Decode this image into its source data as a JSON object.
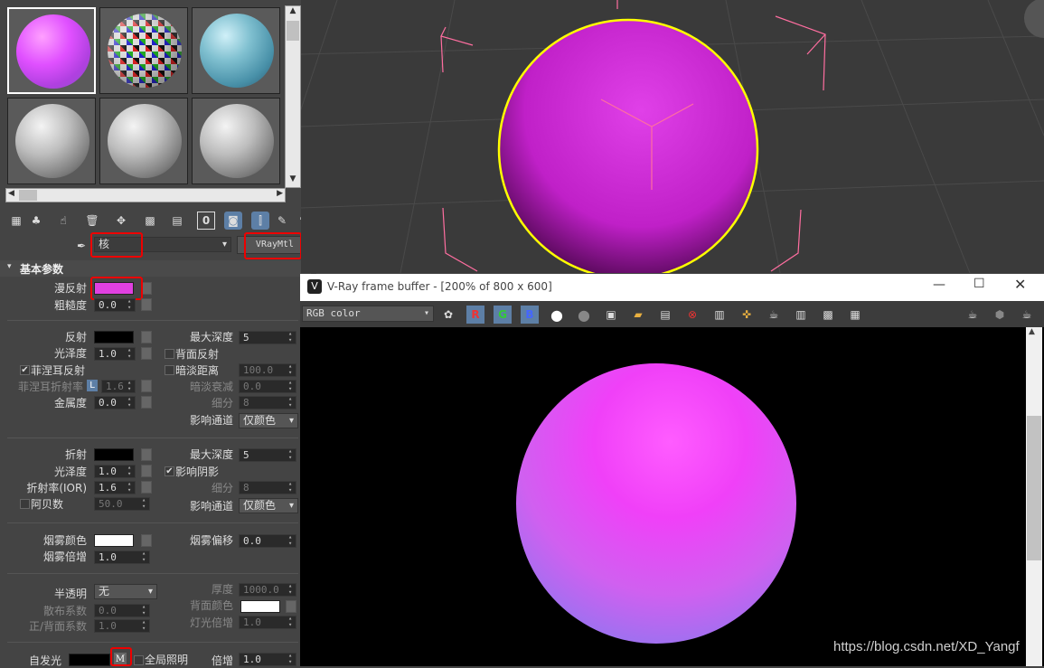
{
  "material_editor": {
    "slots": [
      "pink-sphere",
      "checker-sphere",
      "rock-sphere",
      "gray-sphere",
      "gray-sphere",
      "gray-sphere"
    ],
    "name_value": "核",
    "material_type": "VRayMtl",
    "rollout_title": "基本参数",
    "diffuse": {
      "label": "漫反射",
      "color": "#e040e0"
    },
    "roughness": {
      "label": "粗糙度",
      "value": "0.0"
    },
    "reflection": {
      "label": "反射",
      "color": "#000000"
    },
    "refl_gloss": {
      "label": "光泽度",
      "value": "1.0"
    },
    "fresnel": {
      "label": "菲涅耳反射",
      "checked": "✔"
    },
    "fresnel_ior": {
      "label": "菲涅耳折射率",
      "lock": "L",
      "value": "1.6"
    },
    "metalness": {
      "label": "金属度",
      "value": "0.0"
    },
    "refl_max_depth": {
      "label": "最大深度",
      "value": "5"
    },
    "backside_reflect": {
      "label": "背面反射"
    },
    "dim_distance": {
      "label": "暗淡距离",
      "value": "100.0"
    },
    "dim_falloff": {
      "label": "暗淡衰减",
      "value": "0.0"
    },
    "refl_subdivs": {
      "label": "细分",
      "value": "8"
    },
    "refl_affect_channels": {
      "label": "影响通道",
      "value": "仅颜色"
    },
    "refraction": {
      "label": "折射",
      "color": "#000000"
    },
    "refr_gloss": {
      "label": "光泽度",
      "value": "1.0"
    },
    "ior": {
      "label": "折射率(IOR)",
      "value": "1.6"
    },
    "abbe": {
      "label": "阿贝数",
      "value": "50.0"
    },
    "refr_max_depth": {
      "label": "最大深度",
      "value": "5"
    },
    "affect_shadows": {
      "label": "影响阴影",
      "checked": "✔"
    },
    "refr_subdivs": {
      "label": "细分",
      "value": "8"
    },
    "refr_affect_channels": {
      "label": "影响通道",
      "value": "仅颜色"
    },
    "fog_color": {
      "label": "烟雾颜色",
      "color": "#ffffff"
    },
    "fog_multiplier": {
      "label": "烟雾倍增",
      "value": "1.0"
    },
    "fog_bias": {
      "label": "烟雾偏移",
      "value": "0.0"
    },
    "translucency": {
      "label": "半透明",
      "value": "无"
    },
    "scatter_coeff": {
      "label": "散布系数",
      "value": "0.0"
    },
    "fwd_bck_coeff": {
      "label": "正/背面系数",
      "value": "1.0"
    },
    "thickness": {
      "label": "厚度",
      "value": "1000.0"
    },
    "back_color": {
      "label": "背面颜色",
      "color": "#ffffff"
    },
    "light_multiplier": {
      "label": "灯光倍增",
      "value": "1.0"
    },
    "self_illum": {
      "label": "自发光",
      "color": "#000000",
      "map": "M"
    },
    "gi": {
      "label": "全局照明"
    },
    "self_illum_mult": {
      "label": "倍增",
      "value": "1.0"
    }
  },
  "viewport": {
    "background": "#3a3a3a",
    "sphere_color": "#d830d8"
  },
  "vfb": {
    "title": "V-Ray frame buffer - [200% of 800 x 600]",
    "channel": "RGB color",
    "r": "R",
    "g": "G",
    "b": "B",
    "watermark": "https://blog.csdn.net/XD_Yangf"
  }
}
